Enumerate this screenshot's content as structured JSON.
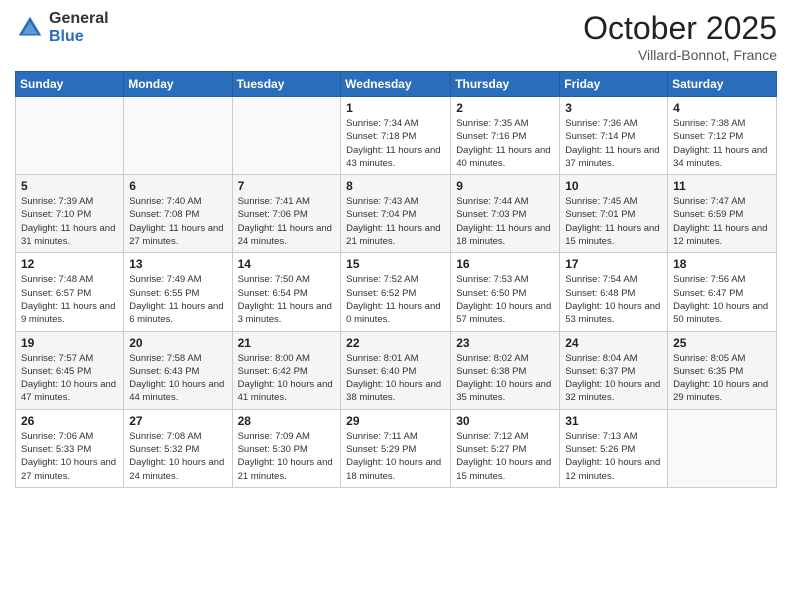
{
  "logo": {
    "general": "General",
    "blue": "Blue"
  },
  "title": {
    "month": "October 2025",
    "location": "Villard-Bonnot, France"
  },
  "weekdays": [
    "Sunday",
    "Monday",
    "Tuesday",
    "Wednesday",
    "Thursday",
    "Friday",
    "Saturday"
  ],
  "weeks": [
    [
      {
        "day": "",
        "info": ""
      },
      {
        "day": "",
        "info": ""
      },
      {
        "day": "",
        "info": ""
      },
      {
        "day": "1",
        "info": "Sunrise: 7:34 AM\nSunset: 7:18 PM\nDaylight: 11 hours\nand 43 minutes."
      },
      {
        "day": "2",
        "info": "Sunrise: 7:35 AM\nSunset: 7:16 PM\nDaylight: 11 hours\nand 40 minutes."
      },
      {
        "day": "3",
        "info": "Sunrise: 7:36 AM\nSunset: 7:14 PM\nDaylight: 11 hours\nand 37 minutes."
      },
      {
        "day": "4",
        "info": "Sunrise: 7:38 AM\nSunset: 7:12 PM\nDaylight: 11 hours\nand 34 minutes."
      }
    ],
    [
      {
        "day": "5",
        "info": "Sunrise: 7:39 AM\nSunset: 7:10 PM\nDaylight: 11 hours\nand 31 minutes."
      },
      {
        "day": "6",
        "info": "Sunrise: 7:40 AM\nSunset: 7:08 PM\nDaylight: 11 hours\nand 27 minutes."
      },
      {
        "day": "7",
        "info": "Sunrise: 7:41 AM\nSunset: 7:06 PM\nDaylight: 11 hours\nand 24 minutes."
      },
      {
        "day": "8",
        "info": "Sunrise: 7:43 AM\nSunset: 7:04 PM\nDaylight: 11 hours\nand 21 minutes."
      },
      {
        "day": "9",
        "info": "Sunrise: 7:44 AM\nSunset: 7:03 PM\nDaylight: 11 hours\nand 18 minutes."
      },
      {
        "day": "10",
        "info": "Sunrise: 7:45 AM\nSunset: 7:01 PM\nDaylight: 11 hours\nand 15 minutes."
      },
      {
        "day": "11",
        "info": "Sunrise: 7:47 AM\nSunset: 6:59 PM\nDaylight: 11 hours\nand 12 minutes."
      }
    ],
    [
      {
        "day": "12",
        "info": "Sunrise: 7:48 AM\nSunset: 6:57 PM\nDaylight: 11 hours\nand 9 minutes."
      },
      {
        "day": "13",
        "info": "Sunrise: 7:49 AM\nSunset: 6:55 PM\nDaylight: 11 hours\nand 6 minutes."
      },
      {
        "day": "14",
        "info": "Sunrise: 7:50 AM\nSunset: 6:54 PM\nDaylight: 11 hours\nand 3 minutes."
      },
      {
        "day": "15",
        "info": "Sunrise: 7:52 AM\nSunset: 6:52 PM\nDaylight: 11 hours\nand 0 minutes."
      },
      {
        "day": "16",
        "info": "Sunrise: 7:53 AM\nSunset: 6:50 PM\nDaylight: 10 hours\nand 57 minutes."
      },
      {
        "day": "17",
        "info": "Sunrise: 7:54 AM\nSunset: 6:48 PM\nDaylight: 10 hours\nand 53 minutes."
      },
      {
        "day": "18",
        "info": "Sunrise: 7:56 AM\nSunset: 6:47 PM\nDaylight: 10 hours\nand 50 minutes."
      }
    ],
    [
      {
        "day": "19",
        "info": "Sunrise: 7:57 AM\nSunset: 6:45 PM\nDaylight: 10 hours\nand 47 minutes."
      },
      {
        "day": "20",
        "info": "Sunrise: 7:58 AM\nSunset: 6:43 PM\nDaylight: 10 hours\nand 44 minutes."
      },
      {
        "day": "21",
        "info": "Sunrise: 8:00 AM\nSunset: 6:42 PM\nDaylight: 10 hours\nand 41 minutes."
      },
      {
        "day": "22",
        "info": "Sunrise: 8:01 AM\nSunset: 6:40 PM\nDaylight: 10 hours\nand 38 minutes."
      },
      {
        "day": "23",
        "info": "Sunrise: 8:02 AM\nSunset: 6:38 PM\nDaylight: 10 hours\nand 35 minutes."
      },
      {
        "day": "24",
        "info": "Sunrise: 8:04 AM\nSunset: 6:37 PM\nDaylight: 10 hours\nand 32 minutes."
      },
      {
        "day": "25",
        "info": "Sunrise: 8:05 AM\nSunset: 6:35 PM\nDaylight: 10 hours\nand 29 minutes."
      }
    ],
    [
      {
        "day": "26",
        "info": "Sunrise: 7:06 AM\nSunset: 5:33 PM\nDaylight: 10 hours\nand 27 minutes."
      },
      {
        "day": "27",
        "info": "Sunrise: 7:08 AM\nSunset: 5:32 PM\nDaylight: 10 hours\nand 24 minutes."
      },
      {
        "day": "28",
        "info": "Sunrise: 7:09 AM\nSunset: 5:30 PM\nDaylight: 10 hours\nand 21 minutes."
      },
      {
        "day": "29",
        "info": "Sunrise: 7:11 AM\nSunset: 5:29 PM\nDaylight: 10 hours\nand 18 minutes."
      },
      {
        "day": "30",
        "info": "Sunrise: 7:12 AM\nSunset: 5:27 PM\nDaylight: 10 hours\nand 15 minutes."
      },
      {
        "day": "31",
        "info": "Sunrise: 7:13 AM\nSunset: 5:26 PM\nDaylight: 10 hours\nand 12 minutes."
      },
      {
        "day": "",
        "info": ""
      }
    ]
  ]
}
